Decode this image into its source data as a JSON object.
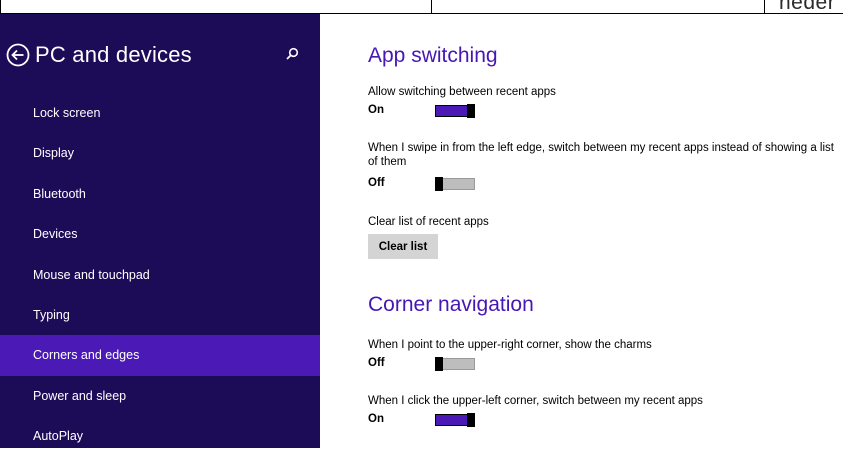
{
  "top_strip": {
    "partial_text": "neder"
  },
  "sidebar": {
    "title": "PC and devices",
    "items": [
      {
        "label": "Lock screen",
        "active": false
      },
      {
        "label": "Display",
        "active": false
      },
      {
        "label": "Bluetooth",
        "active": false
      },
      {
        "label": "Devices",
        "active": false
      },
      {
        "label": "Mouse and touchpad",
        "active": false
      },
      {
        "label": "Typing",
        "active": false
      },
      {
        "label": "Corners and edges",
        "active": true
      },
      {
        "label": "Power and sleep",
        "active": false
      },
      {
        "label": "AutoPlay",
        "active": false
      }
    ],
    "colors": {
      "background": "#1c0b57",
      "active": "#4b19b6"
    }
  },
  "main": {
    "app_switching": {
      "title": "App switching",
      "allow_switching": {
        "label": "Allow switching between recent apps",
        "state": "On",
        "on": true
      },
      "swipe_left_edge": {
        "label": "When I swipe in from the left edge, switch between my recent apps instead of showing a list of them",
        "state": "Off",
        "on": false
      },
      "clear_list": {
        "label": "Clear list of recent apps",
        "button_label": "Clear list"
      }
    },
    "corner_navigation": {
      "title": "Corner navigation",
      "upper_right": {
        "label": "When I point to the upper-right corner, show the charms",
        "state": "Off",
        "on": false
      },
      "upper_left": {
        "label": "When I click the upper-left corner, switch between my recent apps",
        "state": "On",
        "on": true
      }
    },
    "colors": {
      "accent": "#4617b4",
      "toggle_on": "#4b19b6",
      "toggle_off": "#bdbdbd",
      "button": "#d4d4d4"
    }
  },
  "icons": {
    "back": "back-arrow-circle-icon",
    "search": "search-icon"
  }
}
